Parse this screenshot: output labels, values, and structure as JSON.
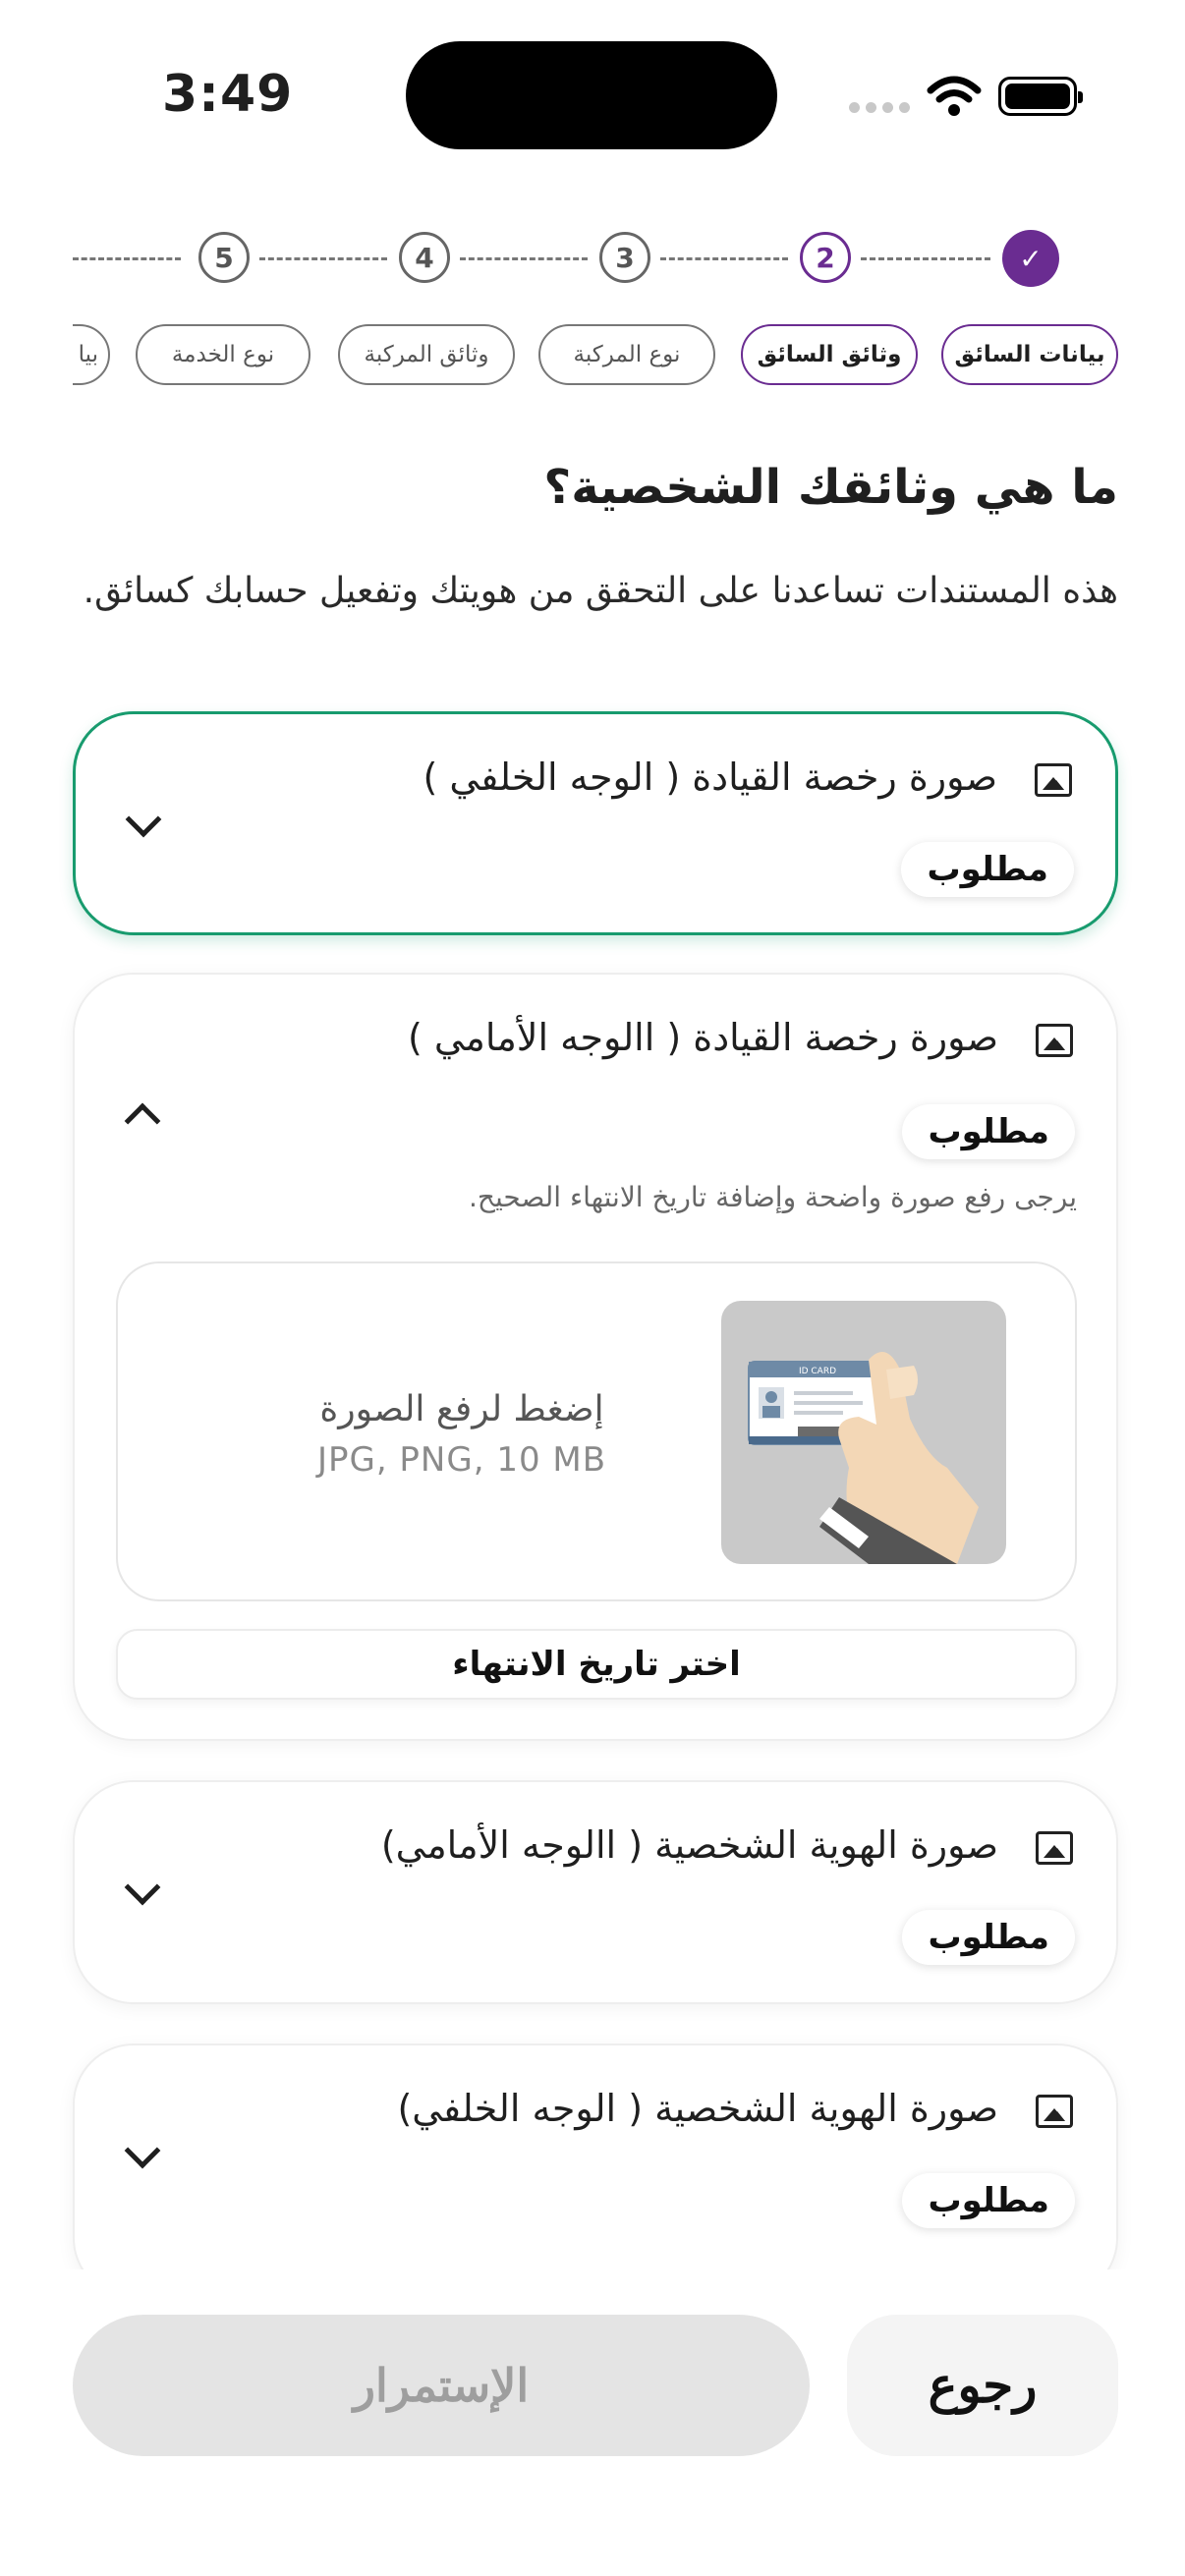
{
  "status_bar": {
    "time": "3:49"
  },
  "stepper": {
    "steps": [
      {
        "label": "5",
        "state": "pending"
      },
      {
        "label": "4",
        "state": "pending"
      },
      {
        "label": "3",
        "state": "pending"
      },
      {
        "label": "2",
        "state": "active"
      },
      {
        "label": "✓",
        "state": "done"
      }
    ]
  },
  "tabs": [
    {
      "label": "بيانات السائق",
      "active": true
    },
    {
      "label": "وثائق السائق",
      "active": true
    },
    {
      "label": "نوع المركبة",
      "active": false
    },
    {
      "label": "وثائق المركبة",
      "active": false
    },
    {
      "label": "نوع الخدمة",
      "active": false
    },
    {
      "label": "بيا",
      "active": false
    }
  ],
  "page": {
    "title": "ما هي وثائقك الشخصية؟",
    "subtitle": "هذه المستندات تساعدنا على التحقق من هويتك وتفعيل حسابك كسائق."
  },
  "documents": [
    {
      "title": "صورة رخصة القيادة ( الوجه الخلفي  )",
      "badge": "مطلوب",
      "expanded": false,
      "focused": true
    },
    {
      "title": "صورة رخصة القيادة ( االوجه الأمامي )",
      "badge": "مطلوب",
      "expanded": true,
      "hint": "يرجى رفع صورة واضحة وإضافة تاريخ الانتهاء الصحيح.",
      "upload_label": "إضغط لرفع الصورة",
      "upload_formats": "JPG, PNG, 10 MB",
      "id_card_label": "ID CARD",
      "date_button": "اختر تاريخ الانتهاء"
    },
    {
      "title": "صورة الهوية الشخصية ( االوجه الأمامي)",
      "badge": "مطلوب",
      "expanded": false
    },
    {
      "title": "صورة الهوية الشخصية ( الوجه الخلفي)",
      "badge": "مطلوب",
      "expanded": false
    }
  ],
  "actions": {
    "continue_label": "الإستمرار",
    "back_label": "رجوع"
  },
  "colors": {
    "brand_purple": "#6a2c91",
    "focus_green": "#189b6e",
    "disabled_bg": "#e4e4e4"
  }
}
